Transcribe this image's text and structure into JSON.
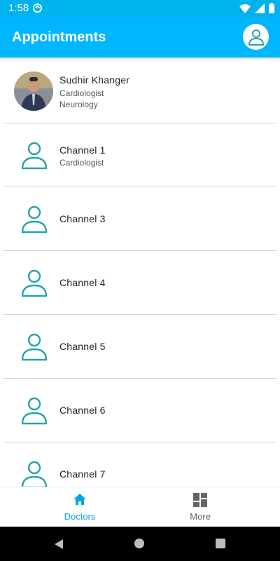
{
  "status": {
    "time": "1:58"
  },
  "app": {
    "title": "Appointments"
  },
  "doctors": [
    {
      "name": "Sudhir Khanger",
      "lines": [
        "Cardiologist",
        "Neurology"
      ],
      "photo": true
    },
    {
      "name": "Channel  1",
      "lines": [
        "Cardiologist"
      ]
    },
    {
      "name": "Channel  3",
      "lines": []
    },
    {
      "name": "Channel  4",
      "lines": []
    },
    {
      "name": "Channel  5",
      "lines": []
    },
    {
      "name": "Channel  6",
      "lines": []
    },
    {
      "name": "Channel  7",
      "lines": []
    }
  ],
  "nav": {
    "doctors_label": "Doctors",
    "more_label": "More"
  },
  "colors": {
    "accent": "#00B7FF",
    "icon_teal": "#22A6A6",
    "inactive": "#666666"
  }
}
